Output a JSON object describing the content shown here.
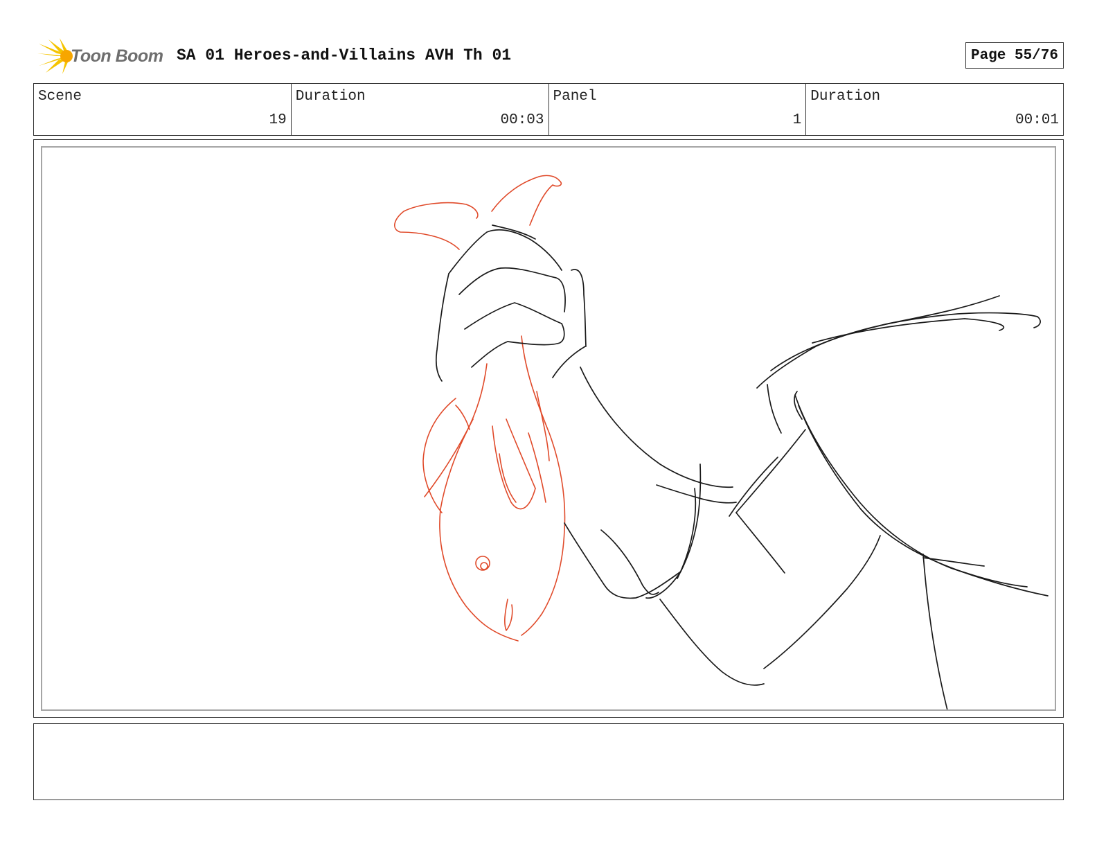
{
  "header": {
    "logo_text": "Toon Boom",
    "title": "SA 01 Heroes-and-Villains AVH Th 01",
    "page": "Page 55/76"
  },
  "info": {
    "scene_label": "Scene",
    "scene_value": "19",
    "scene_duration_label": "Duration",
    "scene_duration_value": "00:03",
    "panel_label": "Panel",
    "panel_value": "1",
    "panel_duration_label": "Duration",
    "panel_duration_value": "00:01"
  },
  "colors": {
    "sketch_black": "#1a1a1a",
    "sketch_red": "#e04a2a",
    "logo_yellow": "#f5c400"
  }
}
